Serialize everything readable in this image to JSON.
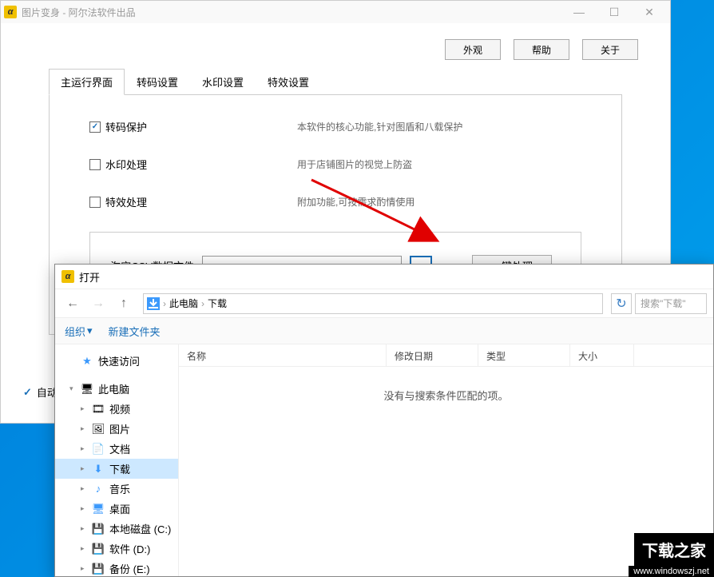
{
  "window": {
    "app_icon_letter": "α",
    "title": "图片变身 - 阿尔法软件出品",
    "minimize": "—",
    "maximize": "☐",
    "close": "✕"
  },
  "top_buttons": {
    "appearance": "外观",
    "help": "帮助",
    "about": "关于"
  },
  "tabs": {
    "main": "主运行界面",
    "transcode": "转码设置",
    "watermark": "水印设置",
    "effect": "特效设置"
  },
  "checkboxes": {
    "transcode_protect": {
      "label": "转码保护",
      "desc": "本软件的核心功能,针对图盾和八载保护"
    },
    "watermark_process": {
      "label": "水印处理",
      "desc": "用于店铺图片的视觉上防盗"
    },
    "effect_process": {
      "label": "特效处理",
      "desc": "附加功能,可按需求酌情使用"
    }
  },
  "csv": {
    "label": "淘宝CSV数据文件",
    "value": "",
    "browse": "...",
    "action": "一键处理"
  },
  "auto": {
    "label": "自动"
  },
  "file_dialog": {
    "title": "打开",
    "breadcrumb": {
      "root": "此电脑",
      "current": "下载"
    },
    "search_placeholder": "搜索\"下载\"",
    "toolbar": {
      "organize": "组织",
      "new_folder": "新建文件夹"
    },
    "sidebar": {
      "quick_access": "快速访问",
      "this_pc": "此电脑",
      "videos": "视频",
      "pictures": "图片",
      "documents": "文档",
      "downloads": "下载",
      "music": "音乐",
      "desktop": "桌面",
      "disk_c": "本地磁盘 (C:)",
      "disk_d": "软件 (D:)",
      "disk_e": "备份 (E:)"
    },
    "columns": {
      "name": "名称",
      "date": "修改日期",
      "type": "类型",
      "size": "大小"
    },
    "empty": "没有与搜索条件匹配的项。"
  },
  "watermark": {
    "text1": "下载之家",
    "text2": "www.windowszj.net"
  }
}
